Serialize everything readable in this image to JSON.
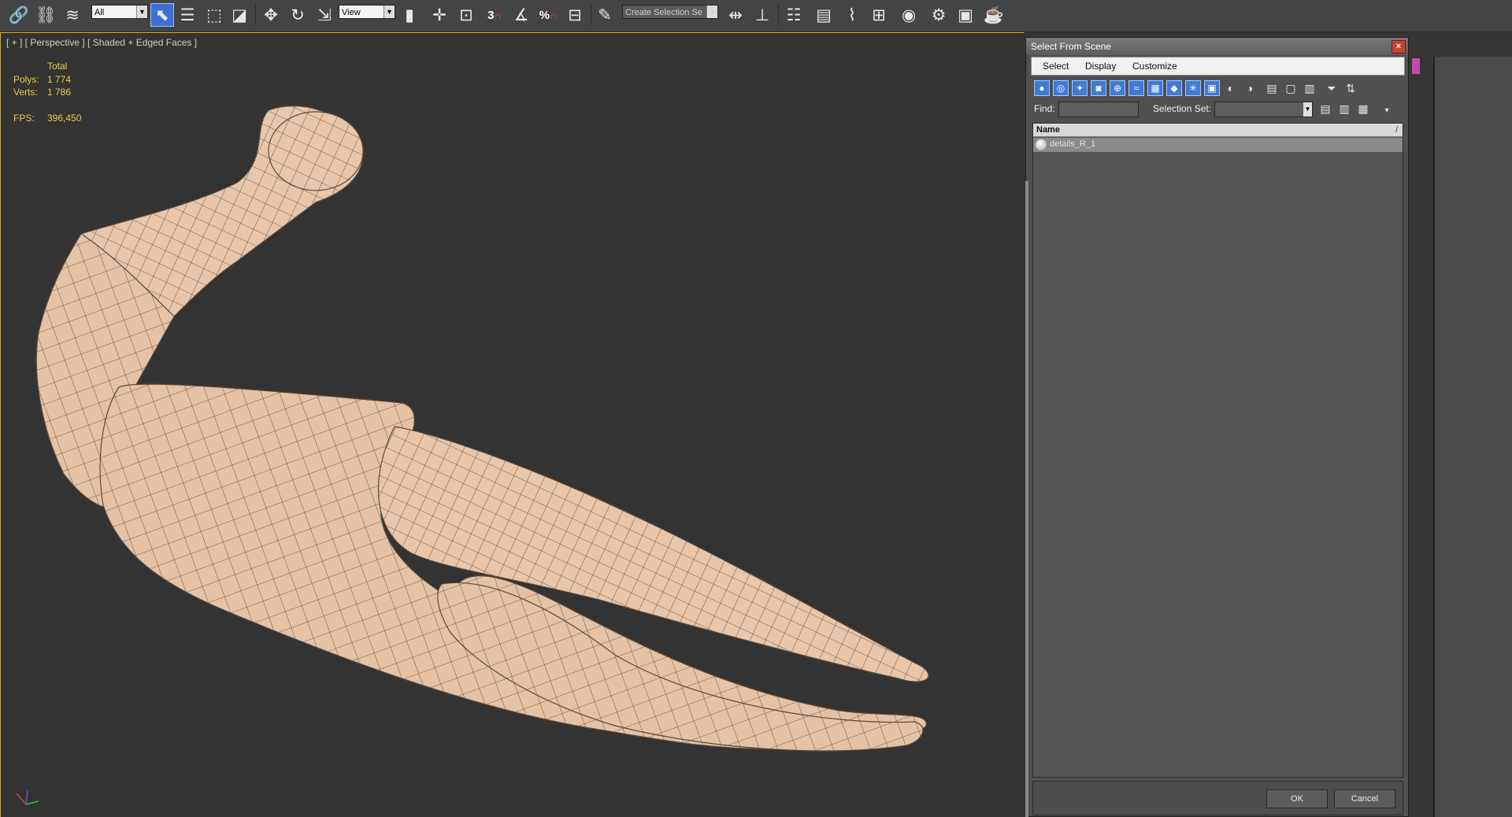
{
  "toolbar": {
    "filter_value": "All",
    "refcoord_value": "View",
    "selection_set_placeholder": "Create Selection Se",
    "snap_labels": {
      "snap": "3",
      "angle": "",
      "percent": "%"
    },
    "icons": [
      "link-icon",
      "unlink-icon",
      "bind-spacewarp-icon",
      "select-object-icon",
      "select-by-name-icon",
      "rect-region-icon",
      "window-crossing-icon",
      "move-icon",
      "rotate-icon",
      "scale-icon",
      "pivot-icon",
      "select-manipulate-icon",
      "keyboard-shortcut-icon",
      "snap-icon",
      "angle-snap-icon",
      "percent-snap-icon",
      "spinner-snap-icon",
      "edit-named-sets-icon",
      "mirror-icon",
      "align-icon",
      "layer-manager-icon",
      "ribbon-icon",
      "curve-editor-icon",
      "schematic-icon",
      "material-editor-icon",
      "render-setup-icon",
      "rendered-frame-icon",
      "render-icon"
    ]
  },
  "viewport": {
    "label": "[ + ] [ Perspective ] [ Shaded + Edged Faces ]",
    "stats": {
      "total_label": "Total",
      "polys_label": "Polys:",
      "polys_value": "1 774",
      "verts_label": "Verts:",
      "verts_value": "1 786",
      "fps_label": "FPS:",
      "fps_value": "396,450"
    },
    "colors": {
      "border": "#d8b21e",
      "mesh": "#e6c2a4",
      "wire": "#4a3a30",
      "stats": "#f2c94c"
    }
  },
  "dialog": {
    "title": "Select From Scene",
    "close": "×",
    "menu": [
      "Select",
      "Display",
      "Customize"
    ],
    "find_label": "Find:",
    "find_value": "",
    "selection_set_label": "Selection Set:",
    "selection_set_value": "",
    "list_header": "Name",
    "list_sort_glyph": "/",
    "items": [
      {
        "name": "details_R_1"
      }
    ],
    "ok": "OK",
    "cancel": "Cancel"
  }
}
